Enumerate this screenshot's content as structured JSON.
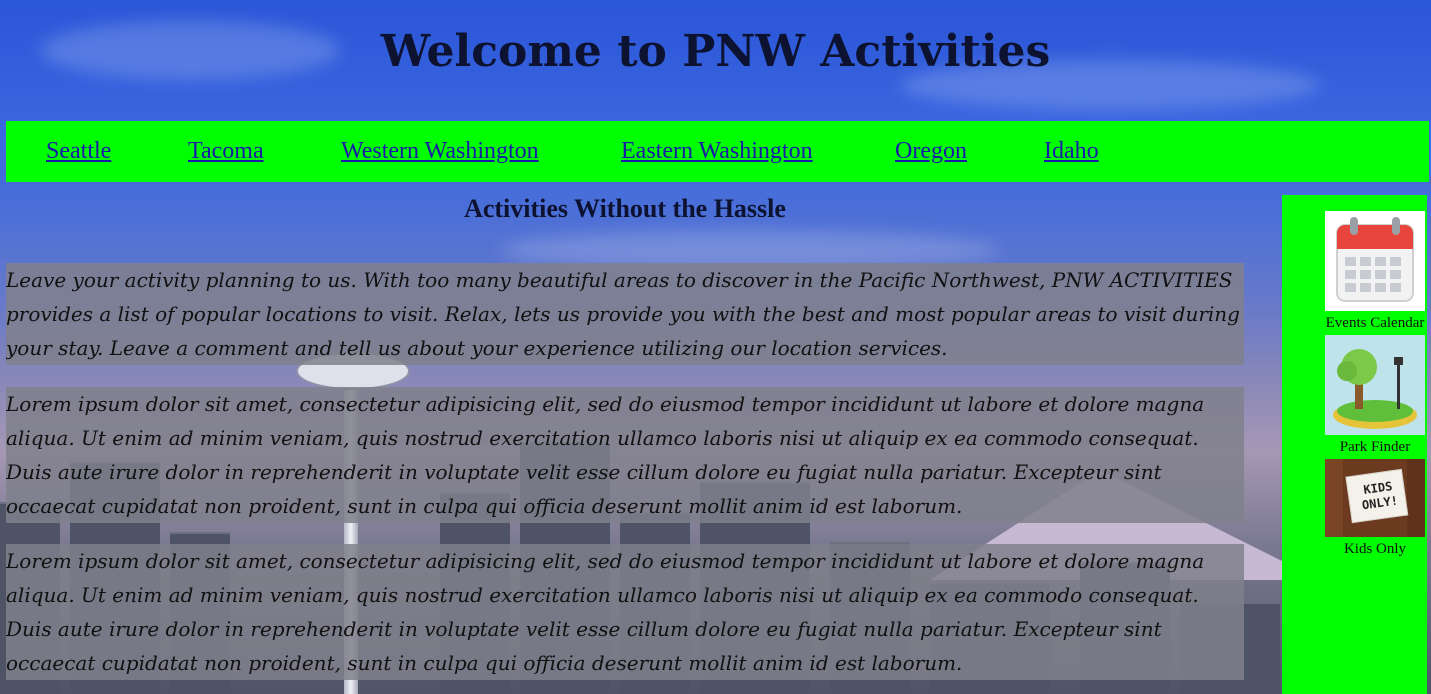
{
  "header": {
    "title": "Welcome to PNW Activities"
  },
  "nav": {
    "links": [
      "Seattle",
      "Tacoma",
      "Western Washington",
      "Eastern Washington",
      "Oregon",
      "Idaho"
    ]
  },
  "main": {
    "subtitle": "Activities Without the Hassle",
    "paragraphs": [
      "Leave your activity planning to us. With too many beautiful areas to discover in the Pacific Northwest, PNW ACTIVITIES provides a list of popular locations to visit. Relax, lets us provide you with the best and most popular areas to visit during your stay. Leave a comment and tell us about your experience utilizing our location services.",
      "Lorem ipsum dolor sit amet, consectetur adipisicing elit, sed do eiusmod tempor incididunt ut labore et dolore magna aliqua. Ut enim ad minim veniam, quis nostrud exercitation ullamco laboris nisi ut aliquip ex ea commodo consequat. Duis aute irure dolor in reprehenderit in voluptate velit esse cillum dolore eu fugiat nulla pariatur. Excepteur sint occaecat cupidatat non proident, sunt in culpa qui officia deserunt mollit anim id est laborum.",
      "Lorem ipsum dolor sit amet, consectetur adipisicing elit, sed do eiusmod tempor incididunt ut labore et dolore magna aliqua. Ut enim ad minim veniam, quis nostrud exercitation ullamco laboris nisi ut aliquip ex ea commodo consequat. Duis aute irure dolor in reprehenderit in voluptate velit esse cillum dolore eu fugiat nulla pariatur. Excepteur sint occaecat cupidatat non proident, sunt in culpa qui officia deserunt mollit anim id est laborum."
    ]
  },
  "sidebar": {
    "items": [
      {
        "label": "Events Calendar",
        "icon": "calendar-icon"
      },
      {
        "label": "Park Finder",
        "icon": "park-icon"
      },
      {
        "label": "Kids Only",
        "icon": "kids-only-sign-icon",
        "sign_text": "KIDS ONLY!"
      }
    ]
  },
  "colors": {
    "nav_bg": "#00ff00",
    "sidebar_bg": "#00ff00",
    "link": "#1a1aa8"
  }
}
